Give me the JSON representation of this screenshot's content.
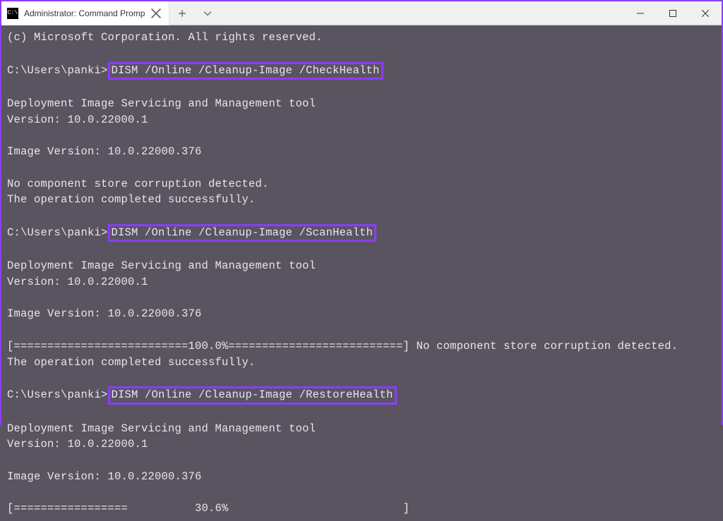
{
  "tab": {
    "title": "Administrator: Command Promp",
    "icon_label": "C:\\"
  },
  "terminal": {
    "copyright": "(c) Microsoft Corporation. All rights reserved.",
    "prompt": "C:\\Users\\panki>",
    "cmd_check": "DISM /Online /Cleanup-Image /CheckHealth",
    "cmd_scan": "DISM /Online /Cleanup-Image /ScanHealth",
    "cmd_restore": "DISM /Online /Cleanup-Image /RestoreHealth",
    "tool_line": "Deployment Image Servicing and Management tool",
    "version_line": "Version: 10.0.22000.1",
    "image_version_line": "Image Version: 10.0.22000.376",
    "no_corruption": "No component store corruption detected.",
    "op_success": "The operation completed successfully.",
    "progress_full": "[==========================100.0%==========================] No component store corruption detected.",
    "progress_partial": "[=================          30.6%                          ]"
  }
}
